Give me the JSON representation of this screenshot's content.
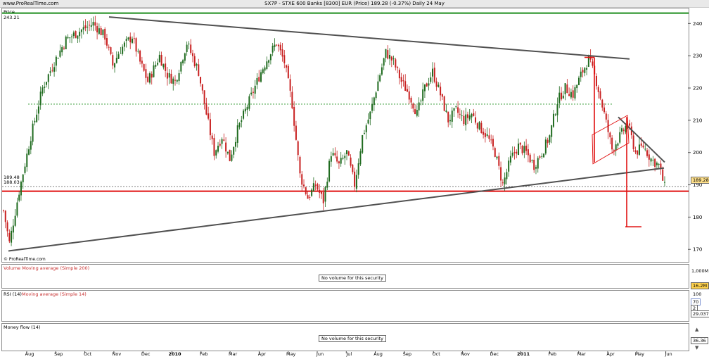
{
  "header": {
    "site": "www.ProRealTime.com",
    "title": "SX7P - STXE 600 Banks [8300] EUR (Price)   189.28 (-0.37%)   Daily  24 May"
  },
  "price_panel": {
    "label": "Price",
    "top_value": "243.21",
    "left_val_1": "189.48",
    "left_val_2": "188.03",
    "copyright": "© ProRealTime.com",
    "current_price_tag": "189.28"
  },
  "volume_panel": {
    "label": "Volume  Moving average (Simple 200)",
    "no_volume": "No volume for this security",
    "axis_label": "1,000M",
    "tag": "16.2M"
  },
  "rsi_panel": {
    "label_rsi": "RSI (14)",
    "label_ma": "Moving average (Simple 14)",
    "axis_label": "100",
    "tag_top": "70",
    "tag_bottom": "29.037",
    "tag_mid": "2"
  },
  "mf_panel": {
    "label": "Money flow (14)",
    "no_volume": "No volume for this security",
    "tag": "36.36"
  },
  "colors": {
    "up_candle": "#1f6b1f",
    "down_candle": "#c82020",
    "trendline": "#505050",
    "support": "#e01010",
    "resistance": "#1a8c1a"
  },
  "chart_data": {
    "type": "candlestick",
    "price_axis_ticks": [
      170,
      180,
      190,
      200,
      210,
      220,
      230,
      240
    ],
    "ylim": [
      167,
      244
    ],
    "time_axis_labels": [
      "Aug",
      "Sep",
      "Oct",
      "Nov",
      "Dec",
      "2010",
      "Feb",
      "Mar",
      "Apr",
      "May",
      "Jun",
      "Jul",
      "Aug",
      "Sep",
      "Oct",
      "Nov",
      "Dec",
      "2011",
      "Feb",
      "Mar",
      "Apr",
      "May",
      "Jun"
    ],
    "reference_levels": {
      "resistance_green": 243.21,
      "support_red": 188.03,
      "dotted_green": 215,
      "dotted_black": 189.48
    },
    "close_path_anchors": [
      {
        "t": 0,
        "v": 182
      },
      {
        "t": 3,
        "v": 172
      },
      {
        "t": 8,
        "v": 188
      },
      {
        "t": 14,
        "v": 205
      },
      {
        "t": 20,
        "v": 220
      },
      {
        "t": 26,
        "v": 228
      },
      {
        "t": 32,
        "v": 235
      },
      {
        "t": 40,
        "v": 238
      },
      {
        "t": 46,
        "v": 240
      },
      {
        "t": 52,
        "v": 236
      },
      {
        "t": 56,
        "v": 227
      },
      {
        "t": 60,
        "v": 232
      },
      {
        "t": 66,
        "v": 236
      },
      {
        "t": 70,
        "v": 228
      },
      {
        "t": 74,
        "v": 222
      },
      {
        "t": 80,
        "v": 230
      },
      {
        "t": 84,
        "v": 224
      },
      {
        "t": 88,
        "v": 222
      },
      {
        "t": 94,
        "v": 234
      },
      {
        "t": 100,
        "v": 225
      },
      {
        "t": 104,
        "v": 212
      },
      {
        "t": 108,
        "v": 200
      },
      {
        "t": 112,
        "v": 205
      },
      {
        "t": 116,
        "v": 198
      },
      {
        "t": 120,
        "v": 207
      },
      {
        "t": 126,
        "v": 216
      },
      {
        "t": 132,
        "v": 225
      },
      {
        "t": 136,
        "v": 230
      },
      {
        "t": 140,
        "v": 234
      },
      {
        "t": 144,
        "v": 228
      },
      {
        "t": 148,
        "v": 215
      },
      {
        "t": 152,
        "v": 193
      },
      {
        "t": 156,
        "v": 186
      },
      {
        "t": 160,
        "v": 190
      },
      {
        "t": 164,
        "v": 185
      },
      {
        "t": 168,
        "v": 200
      },
      {
        "t": 172,
        "v": 196
      },
      {
        "t": 176,
        "v": 200
      },
      {
        "t": 180,
        "v": 190
      },
      {
        "t": 184,
        "v": 205
      },
      {
        "t": 188,
        "v": 212
      },
      {
        "t": 192,
        "v": 222
      },
      {
        "t": 196,
        "v": 231
      },
      {
        "t": 200,
        "v": 228
      },
      {
        "t": 204,
        "v": 222
      },
      {
        "t": 208,
        "v": 218
      },
      {
        "t": 212,
        "v": 212
      },
      {
        "t": 216,
        "v": 220
      },
      {
        "t": 220,
        "v": 225
      },
      {
        "t": 224,
        "v": 218
      },
      {
        "t": 228,
        "v": 210
      },
      {
        "t": 232,
        "v": 213
      },
      {
        "t": 236,
        "v": 210
      },
      {
        "t": 240,
        "v": 212
      },
      {
        "t": 244,
        "v": 208
      },
      {
        "t": 248,
        "v": 205
      },
      {
        "t": 252,
        "v": 200
      },
      {
        "t": 256,
        "v": 190
      },
      {
        "t": 260,
        "v": 198
      },
      {
        "t": 264,
        "v": 202
      },
      {
        "t": 268,
        "v": 200
      },
      {
        "t": 272,
        "v": 196
      },
      {
        "t": 276,
        "v": 200
      },
      {
        "t": 280,
        "v": 205
      },
      {
        "t": 284,
        "v": 216
      },
      {
        "t": 288,
        "v": 220
      },
      {
        "t": 292,
        "v": 218
      },
      {
        "t": 296,
        "v": 224
      },
      {
        "t": 300,
        "v": 229
      },
      {
        "t": 304,
        "v": 222
      },
      {
        "t": 308,
        "v": 212
      },
      {
        "t": 312,
        "v": 201
      },
      {
        "t": 316,
        "v": 205
      },
      {
        "t": 320,
        "v": 209
      },
      {
        "t": 324,
        "v": 200
      },
      {
        "t": 328,
        "v": 202
      },
      {
        "t": 332,
        "v": 198
      },
      {
        "t": 336,
        "v": 196
      },
      {
        "t": 339,
        "v": 189.28
      }
    ]
  }
}
